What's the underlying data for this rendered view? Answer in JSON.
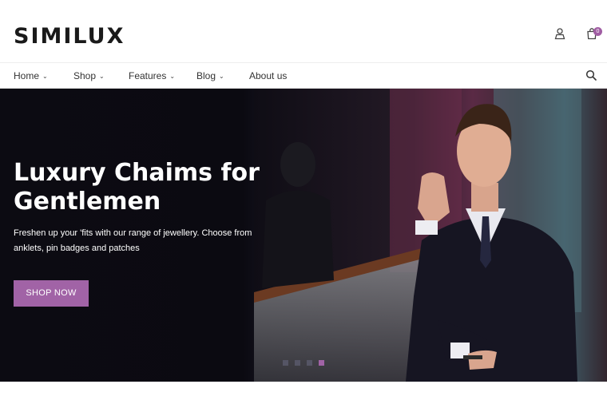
{
  "brand": {
    "logo_text": "SIMILUX"
  },
  "header": {
    "cart_count": "0",
    "icons": {
      "account": "user-icon",
      "cart": "shopping-bag-icon",
      "search": "search-icon"
    }
  },
  "nav": {
    "items": [
      {
        "label": "Home",
        "has_dropdown": true
      },
      {
        "label": "Shop",
        "has_dropdown": true
      },
      {
        "label": "Features",
        "has_dropdown": true
      },
      {
        "label": "Blog",
        "has_dropdown": true
      },
      {
        "label": "About us",
        "has_dropdown": false
      }
    ]
  },
  "hero": {
    "title": "Luxury Chaims for Gentlemen",
    "description": "Freshen up your 'fits with our range of jewellery. Choose from anklets, pin badges and patches",
    "cta_label": "Shop now",
    "slides_total": 4,
    "active_slide": 4
  },
  "colors": {
    "accent": "#a163a6",
    "hero_bg": "#0c0b12",
    "text": "#333333"
  }
}
